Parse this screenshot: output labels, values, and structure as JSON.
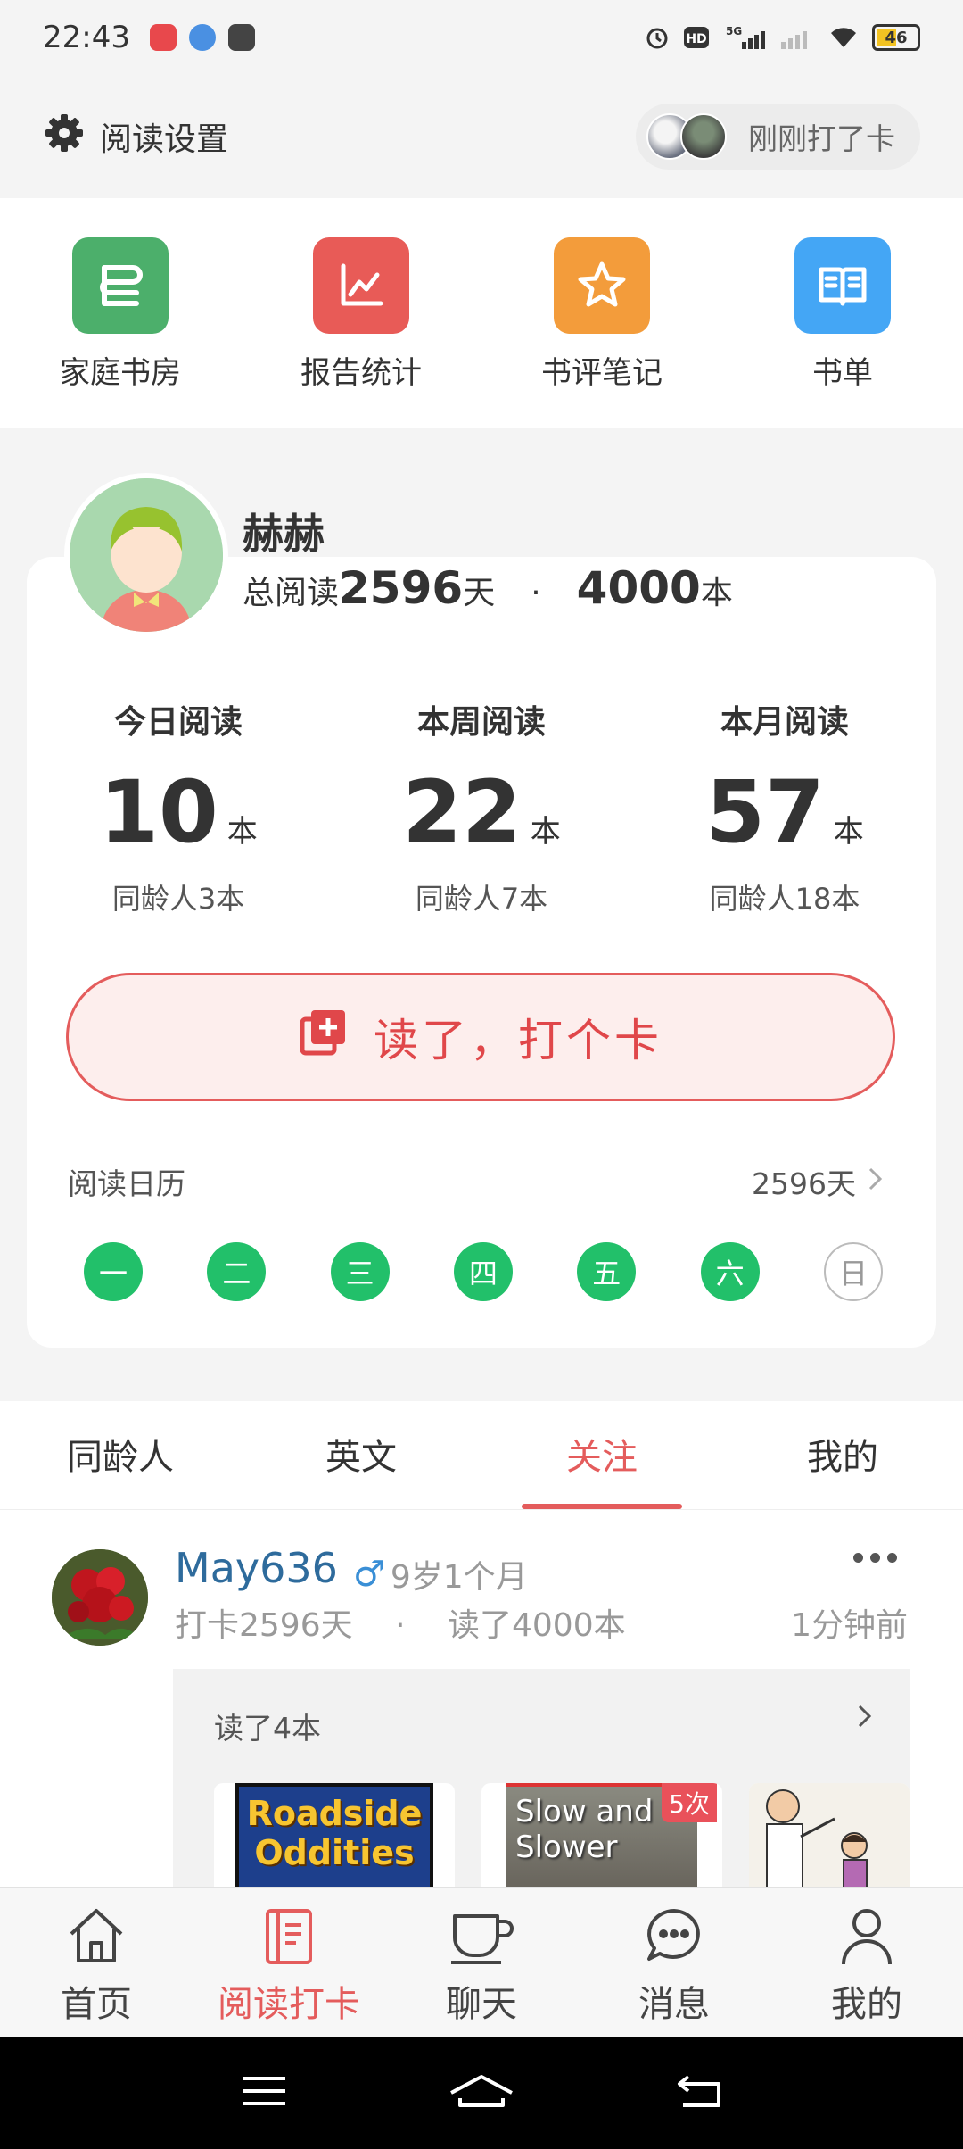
{
  "status_bar": {
    "time": "22:43",
    "network": "5G",
    "battery": "46"
  },
  "header": {
    "settings_label": "阅读设置",
    "checkin_notice": "刚刚打了卡"
  },
  "shortcuts": [
    {
      "label": "家庭书房",
      "icon": "bookshelf-icon",
      "color": "#4caf6b"
    },
    {
      "label": "报告统计",
      "icon": "chart-icon",
      "color": "#e85b57"
    },
    {
      "label": "书评笔记",
      "icon": "star-icon",
      "color": "#f39c3b"
    },
    {
      "label": "书单",
      "icon": "book-open-icon",
      "color": "#44a6f5"
    }
  ],
  "profile": {
    "name": "赫赫",
    "total_prefix": "总阅读",
    "total_days": "2596",
    "days_unit": "天",
    "separator": "·",
    "total_books": "4000",
    "books_unit": "本"
  },
  "stats": [
    {
      "title": "今日阅读",
      "value": "10",
      "unit": "本",
      "peer": "同龄人3本"
    },
    {
      "title": "本周阅读",
      "value": "22",
      "unit": "本",
      "peer": "同龄人7本"
    },
    {
      "title": "本月阅读",
      "value": "57",
      "unit": "本",
      "peer": "同龄人18本"
    }
  ],
  "checkin_button": "读了，打个卡",
  "calendar": {
    "title": "阅读日历",
    "total": "2596天",
    "days": [
      {
        "label": "一",
        "done": true
      },
      {
        "label": "二",
        "done": true
      },
      {
        "label": "三",
        "done": true
      },
      {
        "label": "四",
        "done": true
      },
      {
        "label": "五",
        "done": true
      },
      {
        "label": "六",
        "done": true
      },
      {
        "label": "日",
        "done": false
      }
    ]
  },
  "tabs": [
    {
      "label": "同龄人",
      "active": false
    },
    {
      "label": "英文",
      "active": false
    },
    {
      "label": "关注",
      "active": true
    },
    {
      "label": "我的",
      "active": false
    }
  ],
  "feed": {
    "user": "May636",
    "gender_symbol": "♂",
    "age": "9岁1个月",
    "checkin": "打卡2596天",
    "dot": "·",
    "read_total": "读了4000本",
    "time": "1分钟前",
    "read_title": "读了4本",
    "books": [
      {
        "title": "Roadside Oddities",
        "badge": ""
      },
      {
        "title": "Slow and Slower",
        "badge": "5次"
      }
    ]
  },
  "bottom_nav": [
    {
      "label": "首页",
      "icon": "home-icon",
      "active": false
    },
    {
      "label": "阅读打卡",
      "icon": "notebook-icon",
      "active": true
    },
    {
      "label": "聊天",
      "icon": "cup-icon",
      "active": false
    },
    {
      "label": "消息",
      "icon": "message-icon",
      "active": false
    },
    {
      "label": "我的",
      "icon": "person-icon",
      "active": false
    }
  ],
  "colors": {
    "accent": "#e45c5c",
    "calendar_done": "#22c06a",
    "link": "#2e6b9c"
  }
}
